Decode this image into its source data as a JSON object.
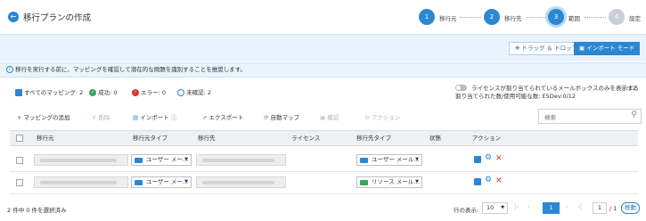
{
  "header": {
    "title": "移行プランの作成",
    "steps": [
      {
        "num": "1",
        "label": "移行元",
        "state": "done"
      },
      {
        "num": "2",
        "label": "移行先",
        "state": "done"
      },
      {
        "num": "3",
        "label": "範囲",
        "state": "current"
      },
      {
        "num": "4",
        "label": "設定",
        "state": "pending"
      }
    ]
  },
  "banner": {
    "drag_drop_label": "ドラッグ ＆ ドロップ",
    "import_mode_label": "インポート モード"
  },
  "info": {
    "text": "移行を実行する前に、マッピングを確認して潜在的な問題を識別することを推奨します。"
  },
  "filters": {
    "all_mappings": "すべてのマッピング: 2",
    "success": "成功: 0",
    "error": "エラー: 0",
    "unconfirmed": "未確認: 2",
    "license_toggle_label": "ライセンスが割り当てられているメールボックスのみを表示する",
    "license_count": "12",
    "assigned_line": "割り当てられた数/使用可能な数:  E5Dev:0/12"
  },
  "toolbar": {
    "add": "マッピングの追加",
    "delete": "削除",
    "import": "インポート",
    "export": "エクスポート",
    "automap": "自動マップ",
    "confirm": "確認",
    "action": "アクション",
    "search_placeholder": "検索"
  },
  "grid": {
    "columns": [
      "移行元",
      "移行元タイプ",
      "移行先",
      "ライセンス",
      "移行先タイプ",
      "状態",
      "アクション"
    ],
    "rows": [
      {
        "source_type": "ユーザー メー...",
        "target_type": "ユーザー メール..."
      },
      {
        "source_type": "ユーザー メー...",
        "target_type": "リソース メール..."
      }
    ]
  },
  "footer": {
    "selection": "2 件中 0 件を選択済み",
    "rows_label": "行の表示:",
    "rows_value": "10",
    "current_page": "1",
    "page_input": "1",
    "page_total": "/ 1",
    "go_label": "移動"
  },
  "colors": {
    "accent": "#2b87d1",
    "pending": "#c9cfd5",
    "success": "#3aa655",
    "error": "#d9342b"
  }
}
